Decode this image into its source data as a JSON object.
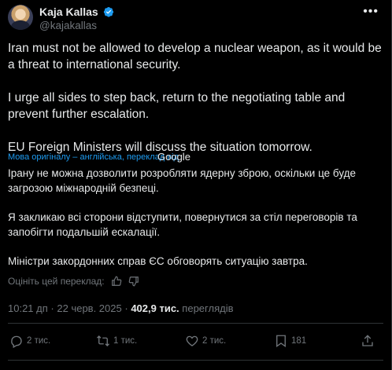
{
  "author": {
    "name": "Kaja Kallas",
    "handle": "@kajakallas",
    "verified_color": "#1d9bf0"
  },
  "menu_icon": "more-horizontal-icon",
  "tweet": {
    "paragraphs": [
      "Iran must not be allowed to develop a nuclear weapon, as it would be a threat to international security.",
      "I urge all sides to step back, return to the negotiating table and prevent further escalation.",
      "EU Foreign Ministers will discuss the situation tomorrow."
    ]
  },
  "translation": {
    "label": "Мова оригіналу – англійська, переклад від",
    "provider": "Google",
    "paragraphs": [
      "Ірану не можна дозволити розробляти ядерну зброю, оскільки це буде загрозою міжнародній безпеці.",
      "Я закликаю всі сторони відступити, повернутися за стіл переговорів та запобігти подальшій ескалації.",
      "Міністри закордонних справ ЄС обговорять ситуацію завтра."
    ],
    "rate_label": "Оцініть цей переклад:"
  },
  "meta": {
    "time": "10:21 дп",
    "separator": "·",
    "date": "22 черв. 2025",
    "views_count": "402,9 тис.",
    "views_label": "переглядів"
  },
  "actions": {
    "replies": "2 тис.",
    "reposts": "1 тис.",
    "likes": "2 тис.",
    "views": "181"
  },
  "colors": {
    "background": "#000000",
    "text": "#e7e9ea",
    "secondary": "#71767b",
    "accent": "#1d9bf0",
    "border": "#2f3336"
  }
}
